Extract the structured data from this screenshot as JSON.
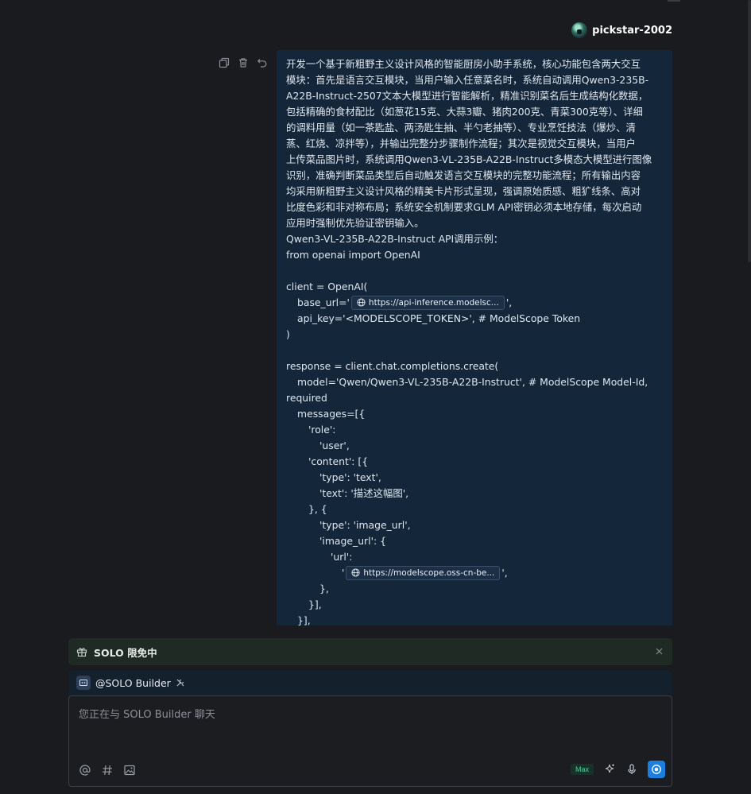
{
  "user": {
    "name": "pickstar-2002"
  },
  "message": {
    "lines": [
      "开发一个基于新粗野主义设计风格的智能厨房小助手系统，核心功能包含两大交互",
      "模块：首先是语言交互模块，当用户输入任意菜名时，系统自动调用Qwen3-235B-",
      "A22B-Instruct-2507文本大模型进行智能解析，精准识别菜名后生成结构化数据，",
      "包括精确的食材配比（如葱花15克、大蒜3瓣、猪肉200克、青菜300克等）、详细",
      "的调料用量（如一茶匙盐、两汤匙生抽、半勺老抽等）、专业烹饪技法（爆炒、清",
      "蒸、红烧、凉拌等），并输出完整分步骤制作流程；其次是视觉交互模块，当用户",
      "上传菜品图片时，系统调用Qwen3-VL-235B-A22B-Instruct多模态大模型进行图像",
      "识别，准确判断菜品类型后自动触发语言交互模块的完整功能流程；所有输出内容",
      "均采用新粗野主义设计风格的精美卡片形式呈现，强调原始质感、粗犷线条、高对",
      "比度色彩和非对称布局；系统安全机制要求GLM API密钥必须本地存储，每次启动",
      "应用时强制优先验证密钥输入。",
      "Qwen3-VL-235B-A22B-Instruct API调用示例：",
      "from openai import OpenAI"
    ],
    "code_client": "client = OpenAI(",
    "base_url_prefix": "base_url='",
    "base_url_link": "https://api-inference.modelsc...",
    "base_url_suffix": "',",
    "api_key_line": "api_key='<MODELSCOPE_TOKEN>', # ModelScope Token",
    "close_paren": ")",
    "response_line": "response = client.chat.completions.create(",
    "model_line": "model='Qwen/Qwen3-VL-235B-A22B-Instruct', # ModelScope Model-Id,",
    "required_line": "required",
    "messages_line": "messages=[{",
    "role_key": "'role':",
    "role_val": "'user',",
    "content_key": "'content': [{",
    "type_text": "'type': 'text',",
    "text_line": "'text': '描述这幅图',",
    "close_brace_open": "}, {",
    "type_image": "'type': 'image_url',",
    "image_url_key": "'image_url': {",
    "url_key": "'url':",
    "url_prefix": "'",
    "url_link": "https://modelscope.oss-cn-be...",
    "url_suffix": "',",
    "close_brace": "},",
    "close_list": "}],",
    "close_msgs": "}],"
  },
  "banner": {
    "label": "SOLO 限免中"
  },
  "composer": {
    "builder_label": "@SOLO Builder",
    "placeholder": "您正在与 SOLO Builder 聊天",
    "max_label": "Max"
  },
  "colors": {
    "background": "#1a1b1f",
    "bubble": "#14273a",
    "accent": "#1a7fe0",
    "max_green": "#4fd19a"
  }
}
